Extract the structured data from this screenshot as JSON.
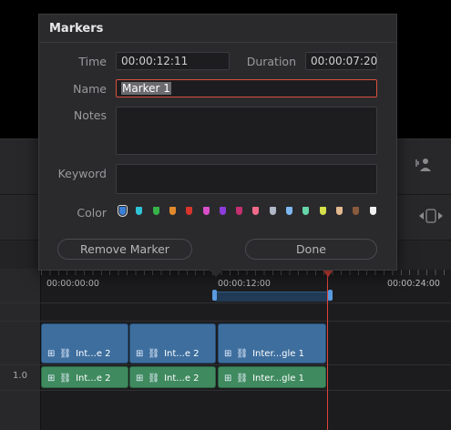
{
  "dialog": {
    "title": "Markers",
    "time_label": "Time",
    "time_value": "00:00:12:11",
    "duration_label": "Duration",
    "duration_value": "00:00:07:20",
    "name_label": "Name",
    "name_value": "Marker 1",
    "notes_label": "Notes",
    "notes_value": "",
    "keyword_label": "Keyword",
    "keyword_value": "",
    "color_label": "Color",
    "colors": [
      "#3a7fd5",
      "#2fc3d6",
      "#37b34a",
      "#e08a2c",
      "#d9352c",
      "#d94fc9",
      "#8d3bd9",
      "#c42f6f",
      "#f06a8a",
      "#b0b7c6",
      "#7eb7ef",
      "#66d6a9",
      "#d7e04a",
      "#e3b88f",
      "#8a5a3c",
      "#f0f0f0"
    ],
    "selected_color": "#3a7fd5",
    "remove_button": "Remove Marker",
    "done_button": "Done"
  },
  "timeline": {
    "timecodes": [
      "00:00:00:00",
      "00:00:12:00",
      "00:00:24:00"
    ],
    "track_number": "1.0",
    "audio_clips": [
      "Int...e 2",
      "Int...e 2",
      "Inter...gle 1"
    ],
    "video_clips": [
      "Int...e 2",
      "Int...e 2",
      "Inter...gle 1"
    ]
  }
}
